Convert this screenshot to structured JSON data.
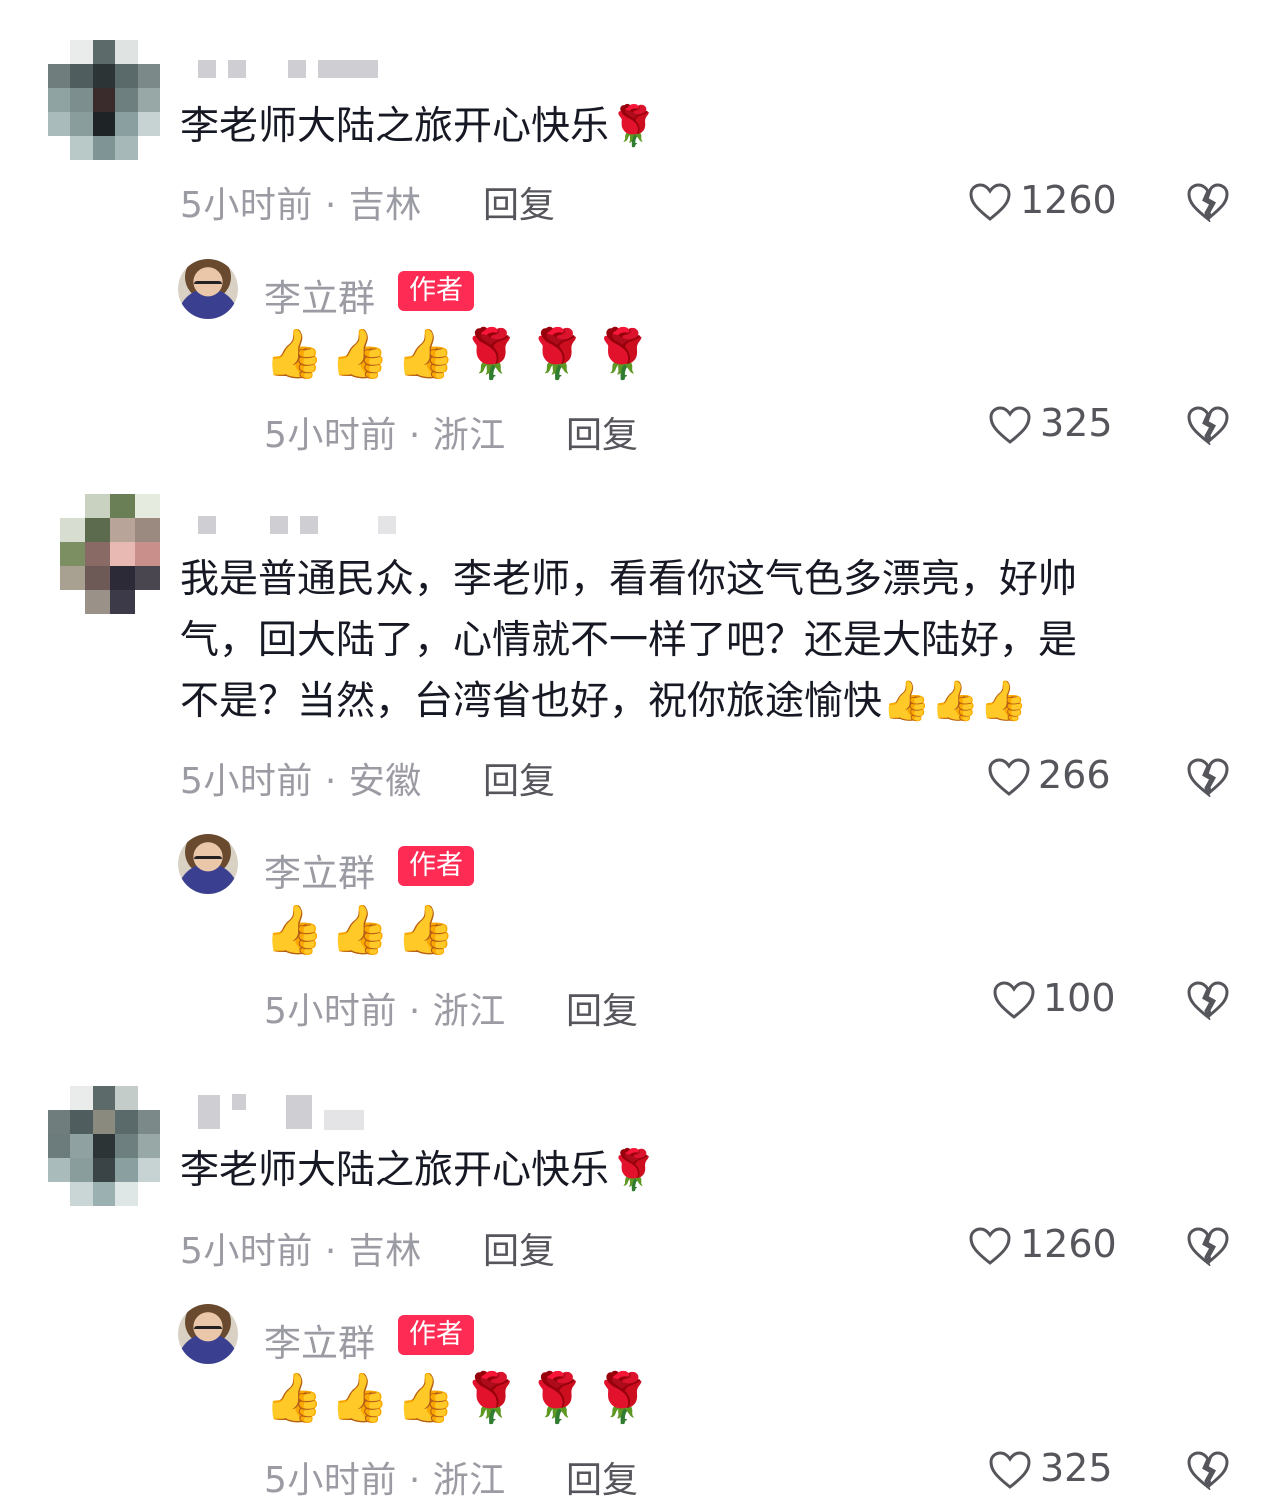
{
  "comments": [
    {
      "text": "李老师大陆之旅开心快乐🌹",
      "time": "5小时前 · 吉林",
      "reply_label": "回复",
      "likes": "1260",
      "author_reply": {
        "name": "李立群",
        "badge": "作者",
        "text": "👍👍👍🌹🌹🌹",
        "time": "5小时前 · 浙江",
        "reply_label": "回复",
        "likes": "325"
      }
    },
    {
      "text_lines": [
        "我是普通民众，李老师，看看你这气色多漂亮，好帅",
        "气，回大陆了，心情就不一样了吧？还是大陆好，是",
        "不是？当然，台湾省也好，祝你旅途愉快👍👍👍"
      ],
      "time": "5小时前 · 安徽",
      "reply_label": "回复",
      "likes": "266",
      "author_reply": {
        "name": "李立群",
        "badge": "作者",
        "text": "👍👍👍",
        "time": "5小时前 · 浙江",
        "reply_label": "回复",
        "likes": "100"
      }
    },
    {
      "text": "李老师大陆之旅开心快乐🌹",
      "time": "5小时前 · 吉林",
      "reply_label": "回复",
      "likes": "1260",
      "author_reply": {
        "name": "李立群",
        "badge": "作者",
        "text": "👍👍👍🌹🌹🌹",
        "time": "5小时前 · 浙江",
        "reply_label": "回复",
        "likes": "325"
      }
    }
  ],
  "colors": {
    "badge": "#fe2c55",
    "meta_text": "#9b9ba3",
    "body_text": "#161823"
  },
  "icons": {
    "like": "heart-outline-icon",
    "dislike": "broken-heart-icon"
  }
}
